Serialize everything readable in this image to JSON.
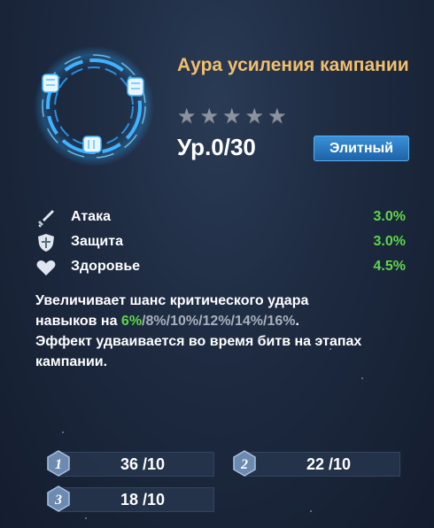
{
  "skill": {
    "title": "Аура усиления кампании",
    "stars_total": 5,
    "stars_filled": 0,
    "level": "Ур.0/30",
    "rarity": "Элитный"
  },
  "stats": [
    {
      "name": "Атака",
      "value": "3.0%",
      "icon": "sword-icon"
    },
    {
      "name": "Защита",
      "value": "3.0%",
      "icon": "shield-icon"
    },
    {
      "name": "Здоровье",
      "value": "4.5%",
      "icon": "heart-icon"
    }
  ],
  "description": {
    "line1": "Увеличивает шанс критического удара",
    "line2_prefix": "навыков на ",
    "line2_active": "6%",
    "line2_rest": "/8%/10%/12%/14%/16%",
    "line2_end": ".",
    "line3": "Эффект удваивается во время битв на этапах",
    "line4": "кампании."
  },
  "requirements": [
    {
      "slot": "1",
      "value": "36 /10"
    },
    {
      "slot": "2",
      "value": "22 /10"
    },
    {
      "slot": "3",
      "value": "18 /10"
    }
  ],
  "colors": {
    "title": "#f3bf6c",
    "stat_value": "#5fd64a",
    "badge": "#2a7cc7",
    "star_empty": "#8c939e"
  }
}
